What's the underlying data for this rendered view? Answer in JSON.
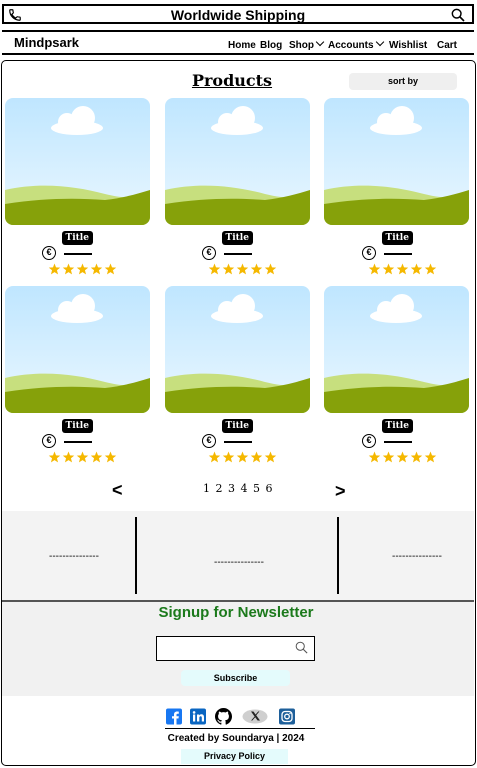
{
  "topbar": {
    "title": "Worldwide Shipping",
    "left_icon": "phone-icon",
    "right_icon": "search-icon"
  },
  "nav": {
    "brand": "Mindpsark",
    "items": [
      {
        "label": "Home"
      },
      {
        "label": "Blog"
      },
      {
        "label": "Shop",
        "dropdown": true
      },
      {
        "label": "Accounts",
        "dropdown": true
      },
      {
        "label": "Wishlist"
      },
      {
        "label": "Cart"
      }
    ]
  },
  "products": {
    "title": "Products",
    "sort_label": "sort by",
    "items": [
      {
        "title": "Title",
        "currency": "€",
        "rating": 5
      },
      {
        "title": "Title",
        "currency": "€",
        "rating": 5
      },
      {
        "title": "Title",
        "currency": "€",
        "rating": 5
      },
      {
        "title": "Title",
        "currency": "€",
        "rating": 5
      },
      {
        "title": "Title",
        "currency": "€",
        "rating": 5
      },
      {
        "title": "Title",
        "currency": "€",
        "rating": 5
      }
    ]
  },
  "pagination": {
    "prev": "<",
    "pages": "1 2 3 4 5 6",
    "next": ">"
  },
  "band": {
    "items": [
      "---------------",
      "---------------",
      "---------------"
    ]
  },
  "newsletter": {
    "title": "Signup for Newsletter",
    "input_value": "",
    "input_icon": "search-icon",
    "button": "Subscribe"
  },
  "footer": {
    "social": [
      "facebook-icon",
      "linkedin-icon",
      "github-icon",
      "x-icon",
      "instagram-icon"
    ],
    "created": "Created by Soundarya | 2024",
    "privacy": "Privacy Policy"
  },
  "colors": {
    "newsletter_title": "#1c7a1c",
    "star": "#f5b800",
    "grass": "#8ba60a",
    "sky": "#cdeeff",
    "subscribe_bg": "#e4fbfc"
  }
}
